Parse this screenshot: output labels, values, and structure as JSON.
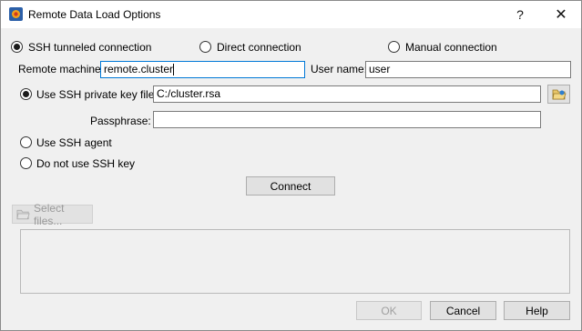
{
  "window": {
    "title": "Remote Data Load Options",
    "help_glyph": "?",
    "close_glyph": "✕"
  },
  "connection": {
    "options": [
      {
        "label": "SSH tunneled connection",
        "checked": true
      },
      {
        "label": "Direct connection",
        "checked": false
      },
      {
        "label": "Manual connection",
        "checked": false
      }
    ]
  },
  "remote_machine": {
    "label": "Remote machine:",
    "value": "remote.cluster"
  },
  "user_name": {
    "label": "User name:",
    "value": "user"
  },
  "key": {
    "use_private_key_label": "Use SSH private key file:",
    "private_key_value": "C:/cluster.rsa",
    "browse_icon": "folder-open-icon",
    "passphrase_label": "Passphrase:",
    "passphrase_value": "",
    "use_agent_label": "Use SSH agent",
    "no_key_label": "Do not use SSH key"
  },
  "actions": {
    "connect_label": "Connect",
    "select_files_label": "Select files...",
    "select_files_icon": "folder-icon",
    "ok_label": "OK",
    "cancel_label": "Cancel",
    "help_label": "Help"
  },
  "colors": {
    "focus_border": "#0078d7",
    "dialog_bg": "#f0f0f0"
  }
}
